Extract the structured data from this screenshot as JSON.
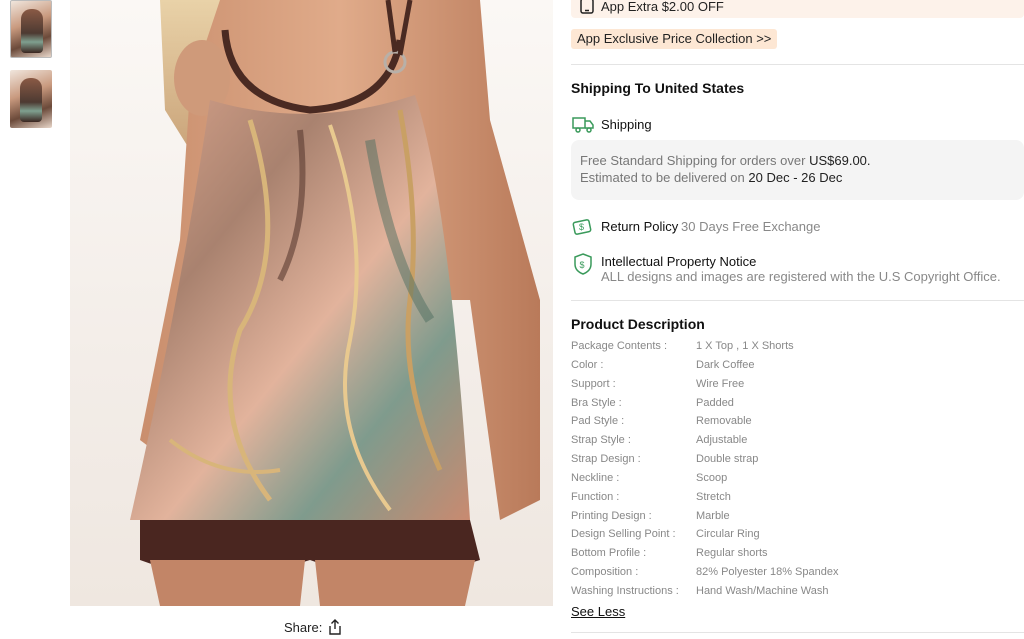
{
  "gallery": {
    "thumbnails": [
      "thumb-1",
      "thumb-2"
    ]
  },
  "share": {
    "label": "Share:",
    "icon": "share-icon"
  },
  "promo": {
    "app_extra": "App Extra $2.00 OFF",
    "app_exclusive": "App Exclusive Price Collection >>"
  },
  "shipping": {
    "title": "Shipping To United States",
    "method_label": "Shipping",
    "free_text": "Free Standard Shipping for orders over ",
    "free_amount": "US$69.00.",
    "delivery_text": "Estimated to be delivered on ",
    "delivery_dates": "20 Dec - 26 Dec",
    "return_label": "Return Policy",
    "return_value": "30 Days Free Exchange",
    "ip_label": "Intellectual Property Notice",
    "ip_text": "ALL designs and images are registered with the U.S Copyright Office."
  },
  "description": {
    "title": "Product Description",
    "rows": [
      {
        "k": "Package Contents :",
        "v": "1 X Top , 1 X Shorts"
      },
      {
        "k": "Color :",
        "v": "Dark Coffee"
      },
      {
        "k": "Support :",
        "v": "Wire Free"
      },
      {
        "k": "Bra Style :",
        "v": "Padded"
      },
      {
        "k": "Pad Style :",
        "v": "Removable"
      },
      {
        "k": "Strap Style :",
        "v": "Adjustable"
      },
      {
        "k": "Strap Design :",
        "v": "Double strap"
      },
      {
        "k": "Neckline :",
        "v": "Scoop"
      },
      {
        "k": "Function :",
        "v": "Stretch"
      },
      {
        "k": "Printing Design :",
        "v": "Marble"
      },
      {
        "k": "Design Selling Point :",
        "v": "Circular Ring"
      },
      {
        "k": "Bottom Profile :",
        "v": "Regular shorts"
      },
      {
        "k": "Composition :",
        "v": "82% Polyester 18% Spandex"
      },
      {
        "k": "Washing Instructions :",
        "v": "Hand Wash/Machine Wash"
      }
    ],
    "see_less": "See Less"
  }
}
